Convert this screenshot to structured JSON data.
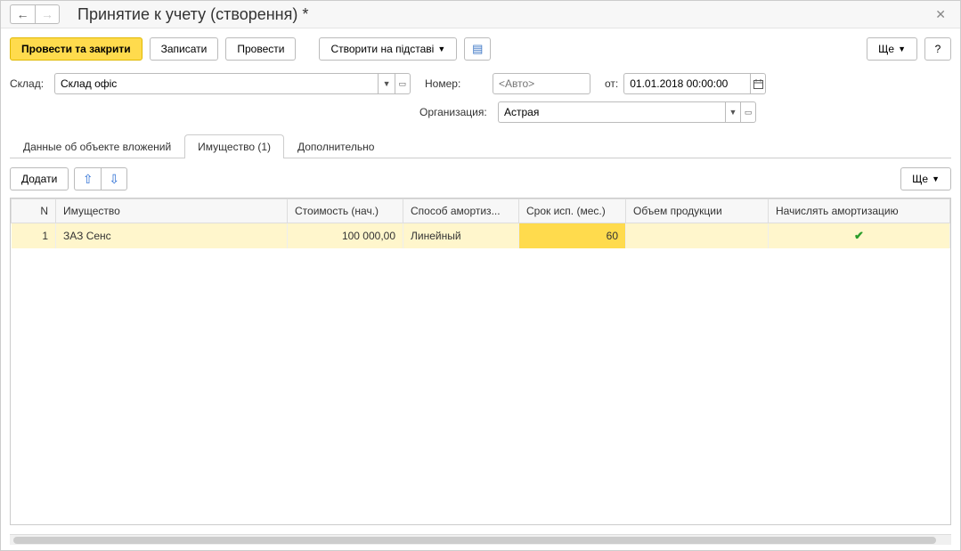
{
  "header": {
    "title": "Принятие к учету (створення) *"
  },
  "toolbar": {
    "post_close": "Провести та закрити",
    "save": "Записати",
    "post": "Провести",
    "create_based": "Створити на підставі",
    "more": "Ще",
    "help": "?"
  },
  "form": {
    "warehouse_label": "Склад:",
    "warehouse_value": "Склад офіс",
    "number_label": "Номер:",
    "number_placeholder": "<Авто>",
    "from_label": "от:",
    "date_value": "01.01.2018 00:00:00",
    "org_label": "Организация:",
    "org_value": "Астрая"
  },
  "tabs": [
    {
      "label": "Данные об объекте вложений"
    },
    {
      "label": "Имущество (1)"
    },
    {
      "label": "Дополнительно"
    }
  ],
  "tableToolbar": {
    "add": "Додати",
    "more": "Ще"
  },
  "table": {
    "headers": {
      "n": "N",
      "property": "Имущество",
      "cost": "Стоимость (нач.)",
      "amort": "Способ амортиз...",
      "term": "Срок исп. (мес.)",
      "volume": "Объем продукции",
      "accrue": "Начислять амортизацию"
    },
    "rows": [
      {
        "n": "1",
        "property": "ЗАЗ Сенс",
        "cost": "100 000,00",
        "amort": "Линейный",
        "term": "60",
        "volume": "",
        "accrue": true
      }
    ]
  }
}
